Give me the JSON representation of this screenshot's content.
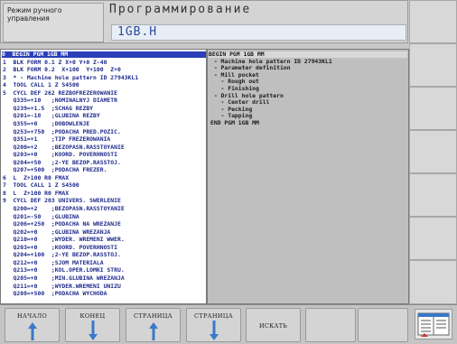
{
  "header": {
    "mode_line1": "Режим ручного",
    "mode_line2": "управления",
    "title": "Программирование",
    "filename": "1GB.H"
  },
  "program": {
    "lines": [
      "0  BEGIN PGM 1GB MM",
      "1  BLK FORM 0.1 Z X+0 Y+0 Z-40",
      "2  BLK FORM 0.2  X+100  Y+100  Z+0",
      "3  * - Machine hole pattern ID 27943KL1",
      "4  TOOL CALL 1 Z S4500",
      "5  CYCL DEF 262 REZBOFREZEROWANIE",
      "   Q335=+10   ;NOMINALNYJ DIAMETR",
      "   Q239=+1.5  ;SCHAG REZBY",
      "   Q201=-18   ;GLUBINA REZBY",
      "   Q355=+0    ;DOBOWLENJE",
      "   Q253=+750  ;PODACHA PRED.POZIC.",
      "   Q351=+1    ;TIP FREZEROWANIA",
      "   Q200=+2    ;BEZOPASN.RASSTOYANIE",
      "   Q203=+0    ;KOORD. POVERHNOSTI",
      "   Q204=+50   ;2-YE BEZOP.RASSTOJ.",
      "   Q207=+500  ;PODACHA FREZER.",
      "6  L  Z+100 R0 FMAX",
      "7  TOOL CALL 1 Z S4500",
      "8  L  Z+100 R0 FMAX",
      "9  CYCL DEF 203 UNIVERS. SWERLENIE",
      "   Q200=+2    ;BEZOPASN.RASSTOYANIE",
      "   Q201=-50   ;GLUBINA",
      "   Q206=+250  ;PODACHA NA WREZANJE",
      "   Q202=+0    ;GLUBINA WREZANJA",
      "   Q210=+0    ;WYDER. WREMENI WWER.",
      "   Q203=+0    ;KOORD. POVERHNOSTI",
      "   Q204=+100  ;2-YE BEZOP.RASSTOJ.",
      "   Q212=+0    ;SJOM MATERIALA",
      "   Q213=+0    ;KOL.OPER.LOMKI STRU.",
      "   Q205=+0    ;MIN.GLUBINA WREZANJA",
      "   Q211=+0    ;WYDER.WREMENI UNIZU",
      "   Q208=+500  ;PODACHA WYCHODA"
    ]
  },
  "structure": {
    "lines": [
      "BEGIN PGM 1GB MM",
      " - Machine hole pattern ID 27943KL1",
      " - Parameter definition",
      " - Mill pocket",
      "   - Rough out",
      "   - Finishing",
      " - Drill hole pattern",
      "   - Center drill",
      "   - Pecking",
      "   - Tapping",
      "END PGM 1GB MM"
    ]
  },
  "softkeys": [
    {
      "label": "НАЧАЛО",
      "arrow": "up"
    },
    {
      "label": "КОНЕЦ",
      "arrow": "down"
    },
    {
      "label": "СТРАНИЦА",
      "arrow": "up"
    },
    {
      "label": "СТРАНИЦА",
      "arrow": "down"
    },
    {
      "label": "ИСКАТЬ",
      "arrow": "none"
    }
  ],
  "colors": {
    "selection": "#2a3fb8",
    "code_text": "#1f2a8c",
    "filename_text": "#2a4a9a"
  },
  "icons": {
    "corner": "split-screen-layout-icon"
  }
}
